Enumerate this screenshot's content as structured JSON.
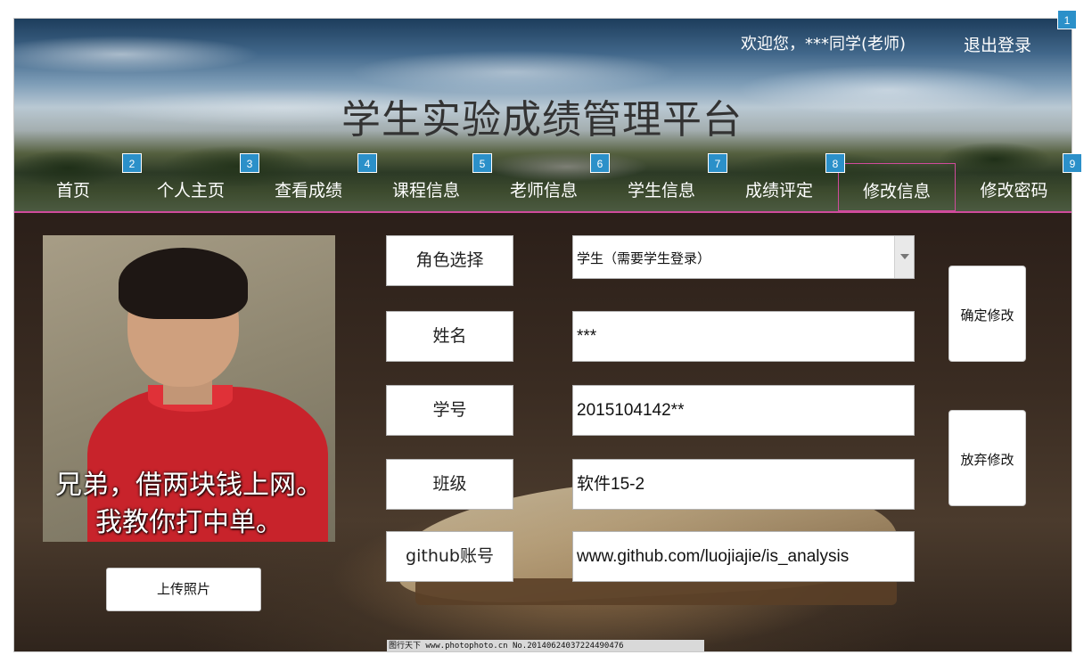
{
  "header": {
    "welcome": "欢迎您，***同学(老师)",
    "logout": "退出登录",
    "title": "学生实验成绩管理平台"
  },
  "nav": {
    "items": [
      {
        "label": "首页"
      },
      {
        "label": "个人主页"
      },
      {
        "label": "查看成绩"
      },
      {
        "label": "课程信息"
      },
      {
        "label": "老师信息"
      },
      {
        "label": "学生信息"
      },
      {
        "label": "成绩评定"
      },
      {
        "label": "修改信息",
        "active": true
      },
      {
        "label": "修改密码"
      }
    ]
  },
  "badges": [
    "1",
    "2",
    "3",
    "4",
    "5",
    "6",
    "7",
    "8",
    "9"
  ],
  "profile": {
    "photo_caption_line1": "兄弟，借两块钱上网。",
    "photo_caption_line2": "我教你打中单。",
    "upload_button": "上传照片"
  },
  "form": {
    "role": {
      "label": "角色选择",
      "selected": "学生（需要学生登录）"
    },
    "name": {
      "label": "姓名",
      "value": "***"
    },
    "student_id": {
      "label": "学号",
      "value": "2015104142**"
    },
    "class": {
      "label": "班级",
      "value": "软件15-2"
    },
    "github": {
      "label": "github账号",
      "value": "www.github.com/luojiajie/is_analysis"
    }
  },
  "actions": {
    "confirm": "确定修改",
    "cancel": "放弃修改"
  },
  "watermark": "图行天下 www.photophoto.cn  No.20140624037224490476",
  "colors": {
    "active_outline": "#d04b9c",
    "badge": "#2b90c9"
  }
}
